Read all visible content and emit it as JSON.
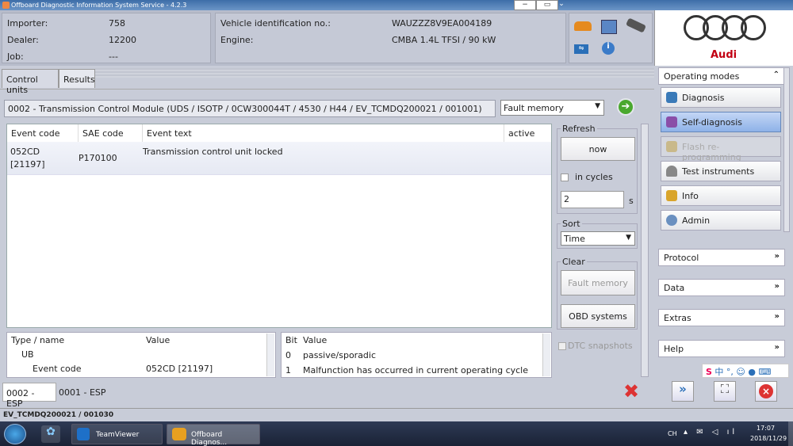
{
  "window": {
    "title": "Offboard Diagnostic Information System Service - 4.2.3"
  },
  "header": {
    "importer_label": "Importer:",
    "importer_value": "758",
    "dealer_label": "Dealer:",
    "dealer_value": "12200",
    "job_label": "Job:",
    "job_value": "---",
    "vin_label": "Vehicle identification no.:",
    "vin_value": "WAUZZZ8V9EA004189",
    "engine_label": "Engine:",
    "engine_value": "CMBA 1.4L TFSI / 90 kW",
    "brand": "Audi"
  },
  "tabs": [
    {
      "label": "Control units"
    },
    {
      "label": "Results"
    }
  ],
  "module": {
    "title": "0002 - Transmission Control Module  (UDS / ISOTP / 0CW300044T / 4530 / H44 / EV_TCMDQ200021 / 001001)",
    "mode": "Fault memory"
  },
  "event_table": {
    "headers": {
      "code": "Event code",
      "sae": "SAE code",
      "text": "Event text",
      "active": "active"
    },
    "rows": [
      {
        "code": "052CD",
        "code2": "[21197]",
        "sae": "P170100",
        "text": "Transmission control unit locked",
        "active": ""
      }
    ]
  },
  "refresh": {
    "label": "Refresh",
    "now": "now",
    "in_cycles": "in cycles",
    "cycles_value": "2",
    "unit": "s"
  },
  "sort": {
    "label": "Sort",
    "value": "Time"
  },
  "clear": {
    "label": "Clear",
    "fault_memory": "Fault memory",
    "obd": "OBD systems"
  },
  "dtc_snapshots": "DTC snapshots",
  "type_table": {
    "headers": {
      "type": "Type / name",
      "value": "Value"
    },
    "rows": [
      {
        "name": "UB",
        "value": ""
      },
      {
        "name": "Event code",
        "value": "052CD [21197]"
      }
    ]
  },
  "bit_table": {
    "headers": {
      "bit": "Bit",
      "value": "Value"
    },
    "rows": [
      {
        "bit": "0",
        "value": "passive/sporadic"
      },
      {
        "bit": "1",
        "value": "Malfunction has occurred in current operating cycle"
      }
    ]
  },
  "bottom_tabs": [
    {
      "label": "0002 - ESP"
    },
    {
      "label": "0001 - ESP"
    }
  ],
  "status": "EV_TCMDQ200021 / 001030",
  "sidebar": {
    "operating_modes": "Operating modes",
    "items": [
      {
        "label": "Diagnosis",
        "icon": "stethoscope-icon",
        "enabled": true
      },
      {
        "label": "Self-diagnosis",
        "icon": "selfdiag-icon",
        "enabled": true
      },
      {
        "label": "Flash re-programming",
        "icon": "flash-icon",
        "enabled": false
      },
      {
        "label": "Test instruments",
        "icon": "gauge-icon",
        "enabled": true
      },
      {
        "label": "Info",
        "icon": "info-book-icon",
        "enabled": true
      },
      {
        "label": "Admin",
        "icon": "admin-icon",
        "enabled": true
      }
    ],
    "sections": [
      "Protocol",
      "Data",
      "Extras",
      "Help"
    ]
  },
  "taskbar": {
    "items": [
      "TeamViewer",
      "Offboard Diagnos..."
    ],
    "clock_time": "17:07",
    "clock_date": "2018/11/29",
    "lang": "CH"
  },
  "colors": {
    "audi_red": "#c20012",
    "selected": "#8eb2e8",
    "go_green": "#4aa82e",
    "close_red": "#d33"
  }
}
